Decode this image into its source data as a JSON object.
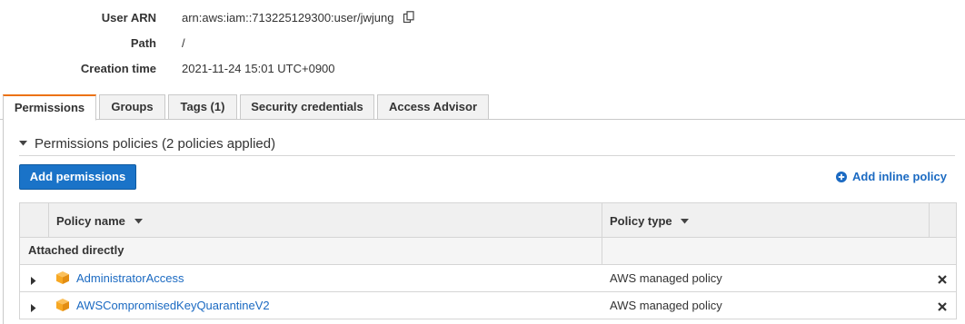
{
  "summary": {
    "user_arn_label": "User ARN",
    "user_arn_value": "arn:aws:iam::713225129300:user/jwjung",
    "path_label": "Path",
    "path_value": "/",
    "creation_label": "Creation time",
    "creation_value": "2021-11-24 15:01 UTC+0900"
  },
  "tabs": [
    {
      "label": "Permissions",
      "active": true
    },
    {
      "label": "Groups",
      "active": false
    },
    {
      "label": "Tags (1)",
      "active": false
    },
    {
      "label": "Security credentials",
      "active": false
    },
    {
      "label": "Access Advisor",
      "active": false
    }
  ],
  "permissions": {
    "section_title": "Permissions policies (2 policies applied)",
    "add_button": "Add permissions",
    "inline_link": "Add inline policy",
    "columns": {
      "name": "Policy name",
      "type": "Policy type"
    },
    "group_label": "Attached directly",
    "policies": [
      {
        "name": "AdministratorAccess",
        "type": "AWS managed policy"
      },
      {
        "name": "AWSCompromisedKeyQuarantineV2",
        "type": "AWS managed policy"
      }
    ]
  },
  "colors": {
    "accent_tab": "#ec7211",
    "primary_button": "#1a73c8",
    "link": "#1b6ac2",
    "policy_box_icon": "#f7a823"
  },
  "icons": [
    "copy-icon",
    "caret-down-icon",
    "plus-circle-icon",
    "sort-down-icon",
    "expand-caret-icon",
    "policy-box-icon",
    "remove-x-icon"
  ]
}
